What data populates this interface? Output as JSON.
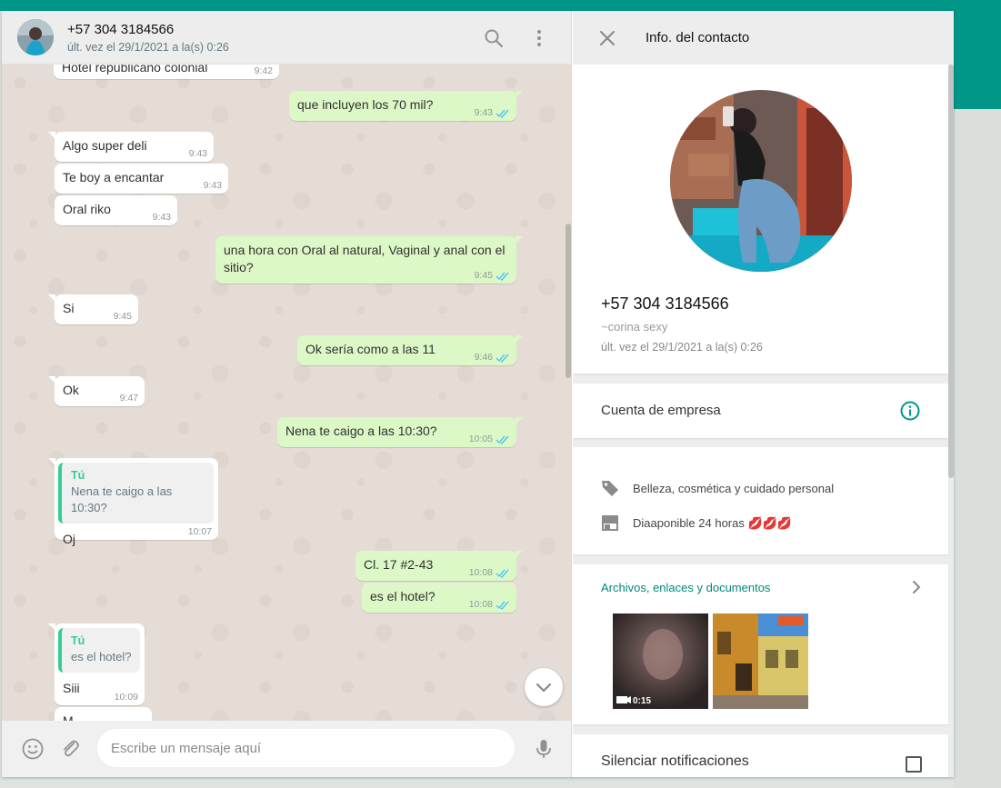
{
  "colors": {
    "accent": "#009688",
    "bubble_out": "#dcf8c6",
    "bubble_in": "#ffffff",
    "read_ticks": "#4fc3f7",
    "quote_author": "#35cd96"
  },
  "chat": {
    "header": {
      "title": "+57 304 3184566",
      "subtitle": "últ. vez el 29/1/2021 a la(s) 0:26"
    },
    "messages": [
      {
        "dir": "in",
        "text": "Hotel republicano colonial",
        "time": "9:42"
      },
      {
        "dir": "out",
        "text": "que incluyen los 70 mil?",
        "time": "9:43"
      },
      {
        "dir": "in",
        "text": "Algo super deli",
        "time": "9:43"
      },
      {
        "dir": "in",
        "text": "Te boy a encantar",
        "time": "9:43"
      },
      {
        "dir": "in",
        "text": "Oral riko",
        "time": "9:43"
      },
      {
        "dir": "out",
        "text": "una hora con Oral al natural, Vaginal y anal con el sitio?",
        "time": "9:45"
      },
      {
        "dir": "in",
        "text": "Si",
        "time": "9:45"
      },
      {
        "dir": "out",
        "text": "Ok sería como a las 11",
        "time": "9:46"
      },
      {
        "dir": "in",
        "text": "Ok",
        "time": "9:47"
      },
      {
        "dir": "out",
        "text": "Nena te caigo a las 10:30?",
        "time": "10:05"
      },
      {
        "dir": "in",
        "quote_author": "Tú",
        "quote_text": "Nena te caigo a las 10:30?",
        "text": "Oj",
        "time": "10:07"
      },
      {
        "dir": "out",
        "text": "Cl. 17 #2-43",
        "time": "10:08"
      },
      {
        "dir": "out",
        "text": "es el hotel?",
        "time": "10:08"
      },
      {
        "dir": "in",
        "quote_author": "Tú",
        "quote_text": "es el hotel?",
        "text": "Siii",
        "time": "10:09"
      },
      {
        "dir": "in",
        "text": "M",
        "time": ""
      }
    ],
    "footer": {
      "placeholder": "Escribe un mensaje aquí"
    }
  },
  "info": {
    "title": "Info. del contacto",
    "name": "+57 304 3184566",
    "about": "~corina sexy",
    "last_seen": "últ. vez el 29/1/2021 a la(s) 0:26",
    "business_label": "Cuenta de empresa",
    "category": "Belleza, cosmética y cuidado personal",
    "hours": "Diaaponible 24 horas 💋💋💋",
    "media_label": "Archivos, enlaces y documentos",
    "media": [
      {
        "type": "video",
        "duration": "0:15"
      },
      {
        "type": "image"
      }
    ],
    "mute_label": "Silenciar notificaciones"
  }
}
